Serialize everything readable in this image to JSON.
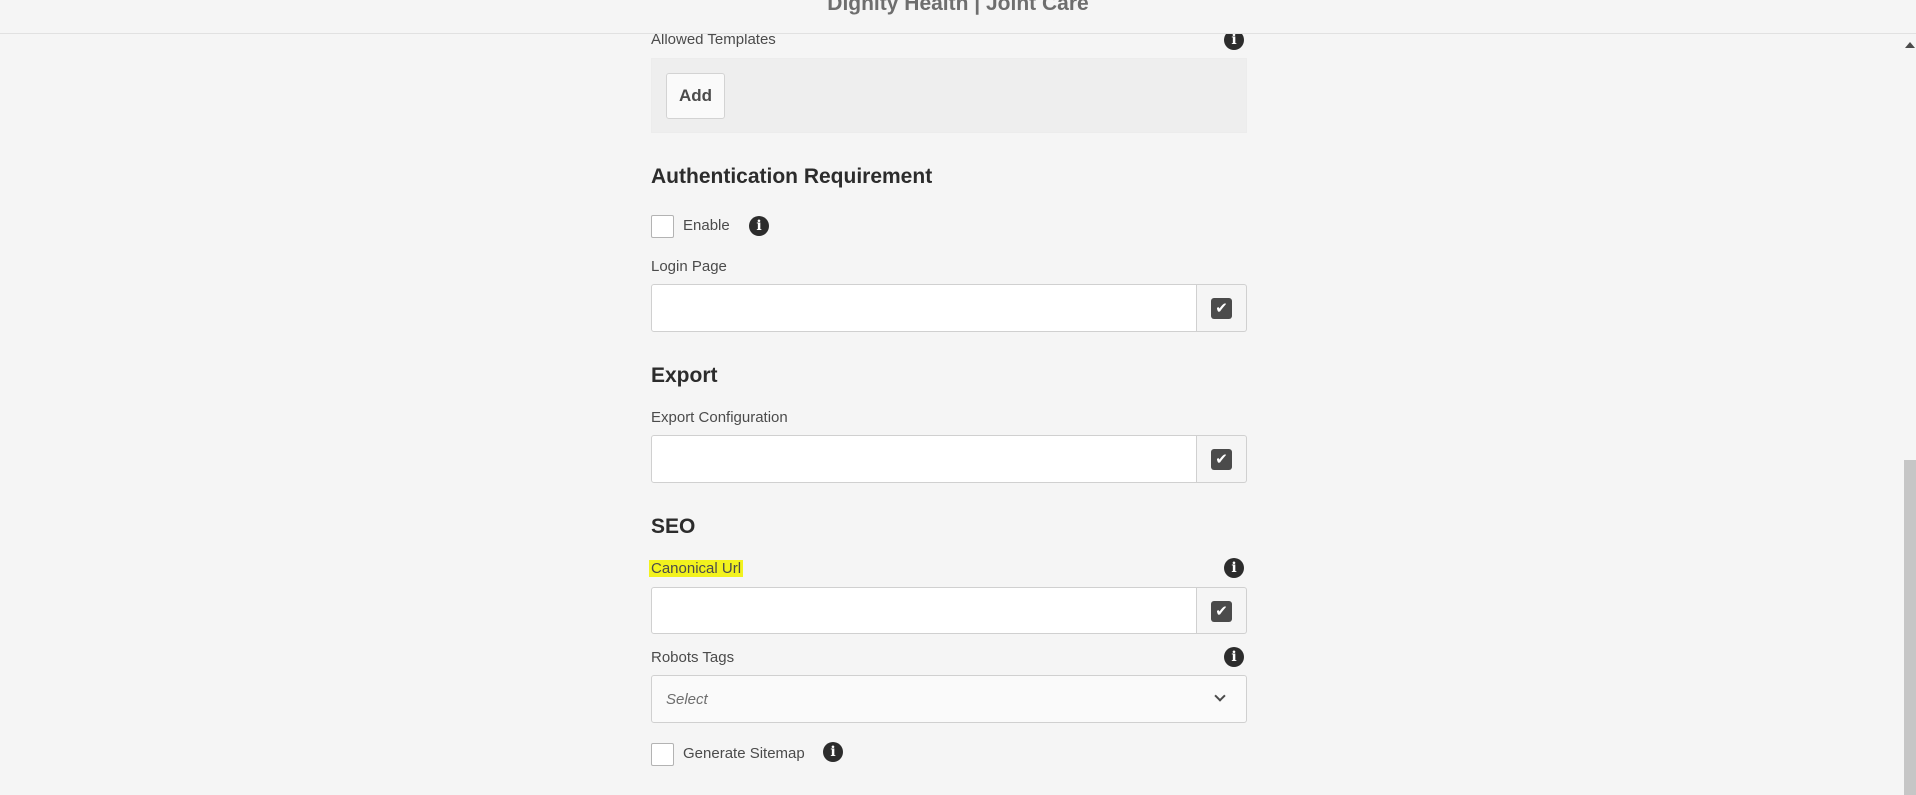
{
  "window": {
    "title": "Dignity Health | Joint Care"
  },
  "allowed_templates": {
    "label": "Allowed Templates",
    "add_label": "Add"
  },
  "authentication": {
    "heading": "Authentication Requirement",
    "enable_label": "Enable",
    "enable_checked": false,
    "login_page_label": "Login Page",
    "login_page_value": ""
  },
  "export": {
    "heading": "Export",
    "config_label": "Export Configuration",
    "config_value": ""
  },
  "seo": {
    "heading": "SEO",
    "canonical_label": "Canonical Url",
    "canonical_value": "",
    "highlight_color": "#f2f21e",
    "robots_label": "Robots Tags",
    "robots_placeholder": "Select",
    "sitemap_label": "Generate Sitemap",
    "sitemap_checked": false
  },
  "icons": {
    "info": "info-icon",
    "check": "checkmark-icon",
    "chevron": "chevron-down-icon"
  },
  "glyphs": {
    "info": "i",
    "check": "✔"
  }
}
